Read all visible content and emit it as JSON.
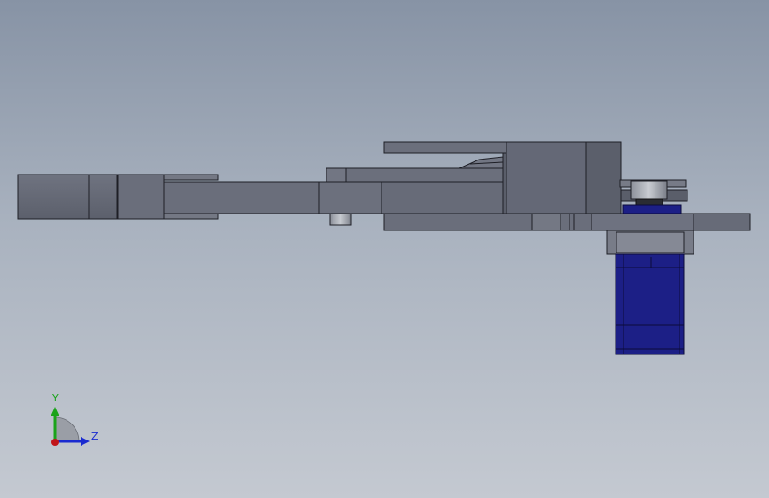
{
  "view": {
    "background_top": "#8793a5",
    "background_bottom": "#c4c9d1",
    "part_color": "#646876",
    "part_edge": "#1e1f26",
    "servo_color": "#1c1f86",
    "servo_edge": "#0b0b3a"
  },
  "triad": {
    "y_label": "Y",
    "z_label": "Z",
    "y_color": "#1aa31a",
    "z_color": "#1a2bd0",
    "x_color": "#c0141a"
  }
}
